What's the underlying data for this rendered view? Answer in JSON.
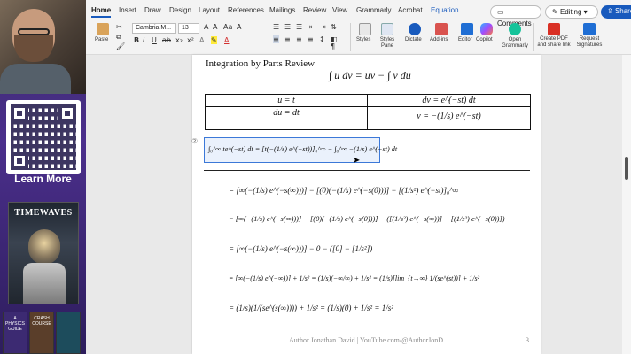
{
  "sidebar": {
    "learn_more": "Learn More",
    "book_title": "TIMEWAVES",
    "mini_books": [
      "A PHYSICS GUIDE",
      "CRASH COURSE",
      ""
    ]
  },
  "ribbon": {
    "tabs": [
      "Home",
      "Insert",
      "Draw",
      "Design",
      "Layout",
      "References",
      "Mailings",
      "Review",
      "View",
      "Grammarly",
      "Acrobat",
      "Equation"
    ],
    "active_tab": "Home",
    "comments": "Comments",
    "editing": "Editing",
    "share": "Share",
    "font_name": "Cambria M...",
    "font_size": "13",
    "paste": "Paste",
    "styles": "Styles",
    "styles_pane": "Styles Pane",
    "dictate": "Dictate",
    "addins": "Add-ins",
    "editor": "Editor",
    "copilot": "Copilot",
    "open_grammarly": "Open Grammarly",
    "create_pdf": "Create PDF and share link",
    "request_sig": "Request Signatures",
    "accent": "#185abd"
  },
  "document": {
    "heading": "Integration by Parts Review",
    "formula": "∫ u dv = uv − ∫ v du",
    "table": {
      "u": "u = t",
      "dv": "dv = e^(−st) dt",
      "du": "du = dt",
      "v": "v = −(1/s) e^(−st)"
    },
    "eq_number": "②",
    "selected_eq": "∫₀^∞ te^(−st) dt = [t(−(1/s) e^(−st))]₀^∞ − ∫₀^∞ −(1/s) e^(−st) dt",
    "steps": [
      "= [∞(−(1/s) e^(−s(∞)))] − [(0)(−(1/s) e^(−s(0)))] − [(1/s²) e^(−st)]₀^∞",
      "= [∞(−(1/s) e^(−s(∞)))] − [(0)(−(1/s) e^(−s(0)))] − ([(1/s²) e^(−s(∞))] − [(1/s²) e^(−s(0))])",
      "= [∞(−(1/s) e^(−s(∞)))] − 0 − ([0] − [1/s²])",
      "= [∞(−(1/s) e^(−∞))] + 1/s² = (1/s)(−∞/∞) + 1/s² = (1/s)[lim_{t→∞} 1/(se^(st))] + 1/s²",
      "= (1/s)(1/(se^(s(∞)))) + 1/s² = (1/s)(0) + 1/s² = 1/s²"
    ],
    "footer": "Author Jonathan David | YouTube.com/@AuthorJonD",
    "page_number": "3"
  }
}
